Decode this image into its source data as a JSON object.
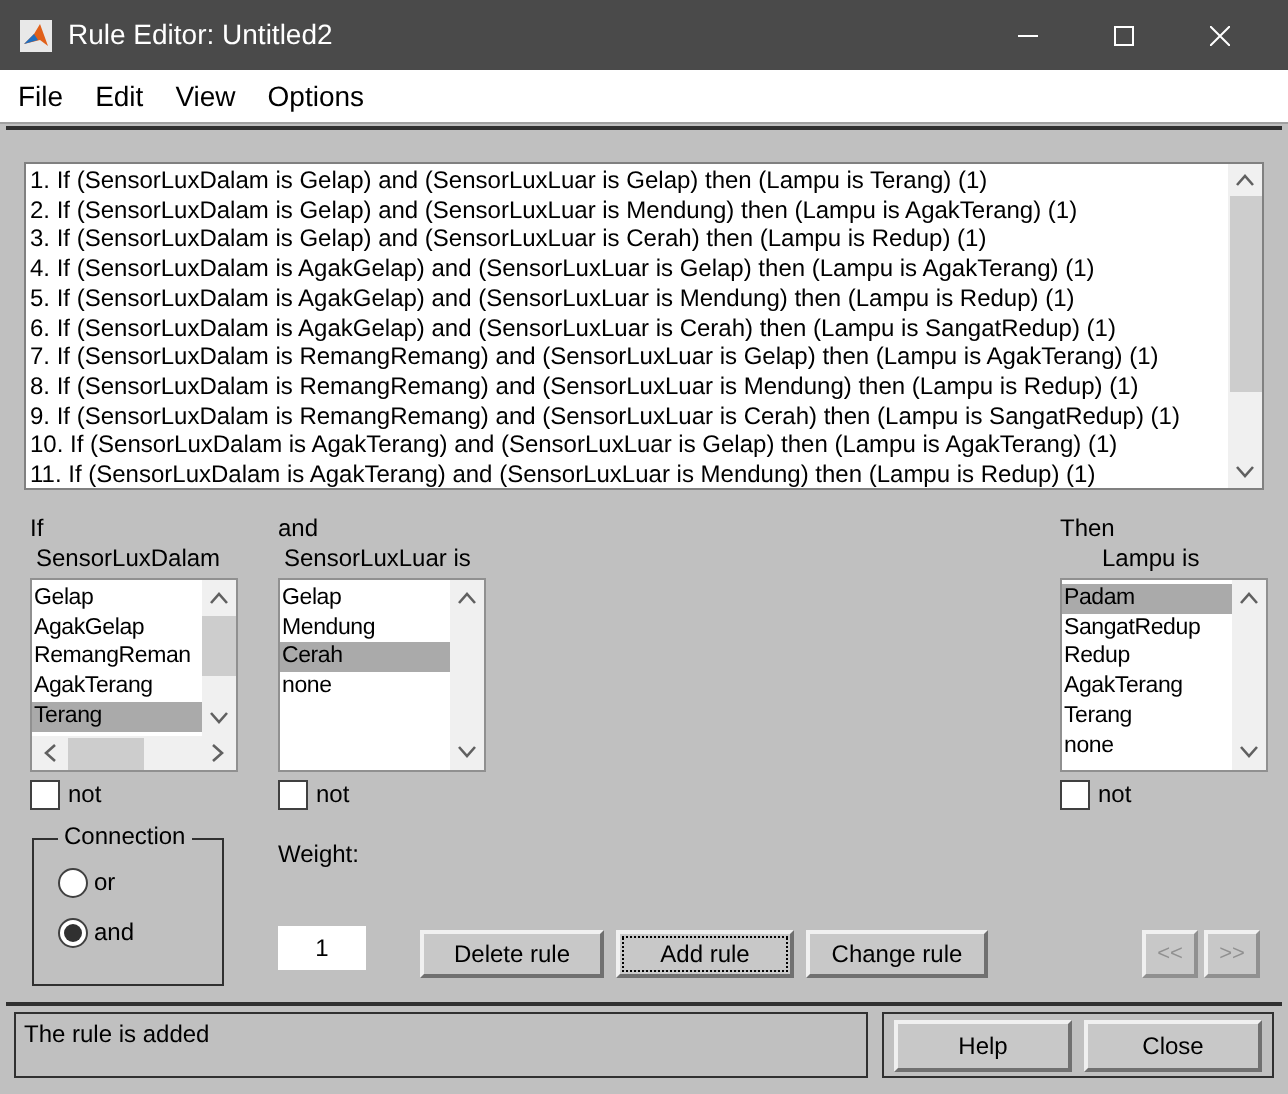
{
  "window": {
    "title": "Rule Editor: Untitled2"
  },
  "menu": [
    "File",
    "Edit",
    "View",
    "Options"
  ],
  "rules": [
    {
      "text": "1. If (SensorLuxDalam is Gelap) and (SensorLuxLuar is Gelap) then (Lampu is Terang) (1)",
      "selected": false
    },
    {
      "text": "2. If (SensorLuxDalam is Gelap) and (SensorLuxLuar is Mendung) then (Lampu is AgakTerang) (1)",
      "selected": false
    },
    {
      "text": "3. If (SensorLuxDalam is Gelap) and (SensorLuxLuar is Cerah) then (Lampu is Redup) (1)",
      "selected": false
    },
    {
      "text": "4. If (SensorLuxDalam is AgakGelap) and (SensorLuxLuar is Gelap) then (Lampu is AgakTerang) (1)",
      "selected": false
    },
    {
      "text": "5. If (SensorLuxDalam is AgakGelap) and (SensorLuxLuar is Mendung) then (Lampu is Redup) (1)",
      "selected": false
    },
    {
      "text": "6. If (SensorLuxDalam is AgakGelap) and (SensorLuxLuar is Cerah) then (Lampu is SangatRedup) (1)",
      "selected": false
    },
    {
      "text": "7. If (SensorLuxDalam is RemangRemang) and (SensorLuxLuar is Gelap) then (Lampu is AgakTerang) (1)",
      "selected": false
    },
    {
      "text": "8. If (SensorLuxDalam is RemangRemang) and (SensorLuxLuar is Mendung) then (Lampu is Redup) (1)",
      "selected": false
    },
    {
      "text": "9. If (SensorLuxDalam is RemangRemang) and (SensorLuxLuar is Cerah) then (Lampu is SangatRedup) (1)",
      "selected": false
    },
    {
      "text": "10. If (SensorLuxDalam is AgakTerang) and (SensorLuxLuar is Gelap) then (Lampu is AgakTerang) (1)",
      "selected": false
    },
    {
      "text": "11. If (SensorLuxDalam is AgakTerang) and (SensorLuxLuar is Mendung) then (Lampu is Redup) (1)",
      "selected": false
    }
  ],
  "inputs": [
    {
      "heading": "If",
      "variable": "SensorLuxDalam",
      "h_scroll": true,
      "not_checked": false,
      "not_label": "not",
      "items": [
        {
          "text": "Gelap",
          "selected": false
        },
        {
          "text": "AgakGelap",
          "selected": false
        },
        {
          "text": "RemangReman",
          "selected": false
        },
        {
          "text": "AgakTerang",
          "selected": false
        },
        {
          "text": "Terang",
          "selected": true
        }
      ]
    },
    {
      "heading": "and",
      "variable": "SensorLuxLuar is",
      "h_scroll": false,
      "not_checked": false,
      "not_label": "not",
      "items": [
        {
          "text": "Gelap",
          "selected": false
        },
        {
          "text": "Mendung",
          "selected": false
        },
        {
          "text": "Cerah",
          "selected": true
        },
        {
          "text": "none",
          "selected": false
        }
      ]
    }
  ],
  "output": {
    "heading": "Then",
    "variable": "Lampu is",
    "h_scroll": false,
    "not_checked": false,
    "not_label": "not",
    "items": [
      {
        "text": "Padam",
        "selected": true
      },
      {
        "text": "SangatRedup",
        "selected": false
      },
      {
        "text": "Redup",
        "selected": false
      },
      {
        "text": "AgakTerang",
        "selected": false
      },
      {
        "text": "Terang",
        "selected": false
      },
      {
        "text": "none",
        "selected": false
      }
    ]
  },
  "connection": {
    "title": "Connection",
    "options": [
      {
        "label": "or",
        "selected": false
      },
      {
        "label": "and",
        "selected": true
      }
    ]
  },
  "weight": {
    "label": "Weight:",
    "value": "1"
  },
  "rule_buttons": [
    {
      "label": "Delete rule",
      "focused": false
    },
    {
      "label": "Add rule",
      "focused": true
    },
    {
      "label": "Change rule",
      "focused": false
    }
  ],
  "nav_buttons": [
    {
      "label": "<<",
      "disabled": true
    },
    {
      "label": ">>",
      "disabled": true
    }
  ],
  "status": "The rule is added",
  "bottom_buttons": [
    "Help",
    "Close"
  ]
}
